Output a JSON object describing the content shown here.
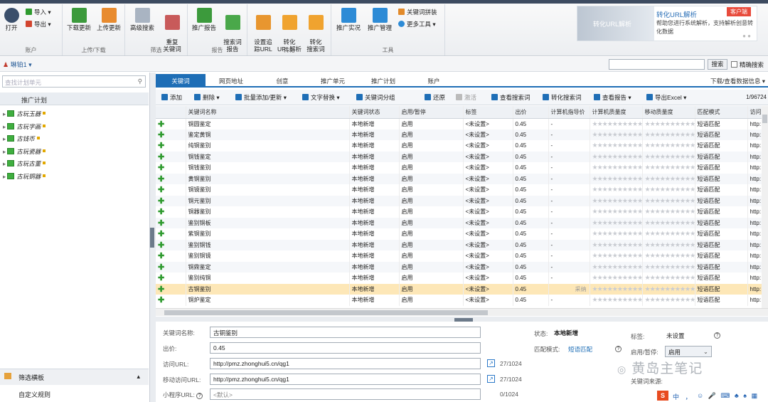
{
  "ribbon": {
    "account": {
      "open": "打开",
      "import": "导入",
      "export": "导出",
      "group": "账户"
    },
    "transfer": {
      "download": "下载更新",
      "upload": "上传更新",
      "group": "上传/下载"
    },
    "filter": {
      "advanced": "高级搜索",
      "duplicate": "重复\n关键词",
      "group": "筛选"
    },
    "report": {
      "promo": "推广报告",
      "search": "搜索词\n报告",
      "group": "报告"
    },
    "convert": {
      "track": "设置追\n踪URL",
      "urlparse": "转化\nURL解析",
      "searchparse": "转化\n搜索词",
      "group": "转化"
    },
    "tools": {
      "realtime": "推广实况",
      "manage": "推广管理",
      "kwpatch": "关键词拼装",
      "more": "更多工具",
      "group": "工具"
    }
  },
  "ad": {
    "image_text": "转化URL解析",
    "title": "转化URL解析",
    "tag": "客户端",
    "desc": "帮助您进行系统解析，支持解析创意转化数据"
  },
  "bar2": {
    "user": "琳铂1",
    "search_btn": "搜索",
    "exact": "精确搜索"
  },
  "left": {
    "search_placeholder": "查找计划单元",
    "header": "推广计划",
    "plans": [
      "古玩玉器",
      "古玩字画",
      "古钱币",
      "古玩瓷器",
      "古玩古董",
      "古玩铜器"
    ],
    "footer1": "筛选横板",
    "footer2": "自定义规则"
  },
  "tabs": [
    "关键词",
    "网页地址",
    "创意",
    "推广单元",
    "推广计划",
    "账户"
  ],
  "download_info": "下载/查看数据信息",
  "toolbar": {
    "add": "添加",
    "delete": "删除",
    "batch": "批量添加/更新",
    "replace": "文字替换",
    "group": "关键词分组",
    "restore": "还原",
    "activate": "激活",
    "search_terms": "查看搜索词",
    "convert_terms": "转化搜索词",
    "report": "查看报告",
    "export": "导出Excel",
    "pager": "1/96724"
  },
  "grid": {
    "columns": [
      "",
      "关键词名称",
      "关键词状态",
      "启用/暂停",
      "标签",
      "出价",
      "计算机指导价",
      "计算机质量度",
      "移动质量度",
      "匹配模式",
      "访问"
    ],
    "rows": [
      {
        "kw": "铜圆鉴定",
        "status": "本地新增",
        "on": "启用",
        "tag": "<未设置>",
        "bid": "0.45",
        "guide": "-",
        "q": "0",
        "m": "0",
        "mode": "短语匹配",
        "url": "http:"
      },
      {
        "kw": "鉴定黄铜",
        "status": "本地新增",
        "on": "启用",
        "tag": "<未设置>",
        "bid": "0.45",
        "guide": "-",
        "q": "0",
        "m": "0",
        "mode": "短语匹配",
        "url": "http:"
      },
      {
        "kw": "纯铜鉴别",
        "status": "本地新增",
        "on": "启用",
        "tag": "<未设置>",
        "bid": "0.45",
        "guide": "-",
        "q": "0",
        "m": "0",
        "mode": "短语匹配",
        "url": "http:"
      },
      {
        "kw": "铜钱鉴定",
        "status": "本地新增",
        "on": "启用",
        "tag": "<未设置>",
        "bid": "0.45",
        "guide": "-",
        "q": "0",
        "m": "0",
        "mode": "短语匹配",
        "url": "http:"
      },
      {
        "kw": "铜钱鉴别",
        "status": "本地新增",
        "on": "启用",
        "tag": "<未设置>",
        "bid": "0.45",
        "guide": "-",
        "q": "0",
        "m": "0",
        "mode": "短语匹配",
        "url": "http:"
      },
      {
        "kw": "黄铜鉴别",
        "status": "本地新增",
        "on": "启用",
        "tag": "<未设置>",
        "bid": "0.45",
        "guide": "-",
        "q": "0",
        "m": "0",
        "mode": "短语匹配",
        "url": "http:"
      },
      {
        "kw": "铜镜鉴别",
        "status": "本地新增",
        "on": "启用",
        "tag": "<未设置>",
        "bid": "0.45",
        "guide": "-",
        "q": "0",
        "m": "0",
        "mode": "短语匹配",
        "url": "http:"
      },
      {
        "kw": "铜元鉴别",
        "status": "本地新增",
        "on": "启用",
        "tag": "<未设置>",
        "bid": "0.45",
        "guide": "-",
        "q": "0",
        "m": "0",
        "mode": "短语匹配",
        "url": "http:"
      },
      {
        "kw": "铜器鉴别",
        "status": "本地新增",
        "on": "启用",
        "tag": "<未设置>",
        "bid": "0.45",
        "guide": "-",
        "q": "0",
        "m": "0",
        "mode": "短语匹配",
        "url": "http:"
      },
      {
        "kw": "鉴别铜板",
        "status": "本地新增",
        "on": "启用",
        "tag": "<未设置>",
        "bid": "0.45",
        "guide": "-",
        "q": "0",
        "m": "0",
        "mode": "短语匹配",
        "url": "http:"
      },
      {
        "kw": "紫铜鉴别",
        "status": "本地新增",
        "on": "启用",
        "tag": "<未设置>",
        "bid": "0.45",
        "guide": "-",
        "q": "0",
        "m": "0",
        "mode": "短语匹配",
        "url": "http:"
      },
      {
        "kw": "鉴别铜钱",
        "status": "本地新增",
        "on": "启用",
        "tag": "<未设置>",
        "bid": "0.45",
        "guide": "-",
        "q": "0",
        "m": "0",
        "mode": "短语匹配",
        "url": "http:"
      },
      {
        "kw": "鉴别铜镜",
        "status": "本地新增",
        "on": "启用",
        "tag": "<未设置>",
        "bid": "0.45",
        "guide": "-",
        "q": "0",
        "m": "0",
        "mode": "短语匹配",
        "url": "http:"
      },
      {
        "kw": "铜鼎鉴定",
        "status": "本地新增",
        "on": "启用",
        "tag": "<未设置>",
        "bid": "0.45",
        "guide": "-",
        "q": "0",
        "m": "0",
        "mode": "短语匹配",
        "url": "http:"
      },
      {
        "kw": "鉴别纯铜",
        "status": "本地新增",
        "on": "启用",
        "tag": "<未设置>",
        "bid": "0.45",
        "guide": "-",
        "q": "0",
        "m": "0",
        "mode": "短语匹配",
        "url": "http:"
      },
      {
        "kw": "古铜鉴别",
        "status": "本地新增",
        "on": "启用",
        "tag": "<未设置>",
        "bid": "0.45",
        "guide": "采纳",
        "q": "0",
        "m": "0",
        "mode": "短语匹配",
        "url": "http:",
        "selected": true
      },
      {
        "kw": "铜炉鉴定",
        "status": "本地新增",
        "on": "启用",
        "tag": "<未设置>",
        "bid": "0.45",
        "guide": "-",
        "q": "0",
        "m": "0",
        "mode": "短语匹配",
        "url": "http:"
      }
    ]
  },
  "detail": {
    "kw_label": "关键词名称:",
    "kw_value": "古铜鉴别",
    "bid_label": "出价:",
    "bid_value": "0.45",
    "url_label": "访问URL:",
    "url_value": "http://pmz.zhonghui5.cn/qg1",
    "url_count": "27/1024",
    "murl_label": "移动访问URL:",
    "murl_value": "http://pmz.zhonghui5.cn/qg1",
    "murl_count": "27/1024",
    "mini_label": "小程序URL:",
    "mini_value": "<默认>",
    "mini_count": "0/1024",
    "status_label": "状态:",
    "status_value": "本地新增",
    "match_label": "匹配模式:",
    "match_value": "短语匹配",
    "tag_label": "标签:",
    "tag_value": "未设置",
    "onoff_label": "启用/暂停:",
    "onoff_value": "启用",
    "source_label": "关键词来源:"
  },
  "watermark": "黄岛主笔记",
  "ime": {
    "logo": "S",
    "text": "中 ，"
  }
}
